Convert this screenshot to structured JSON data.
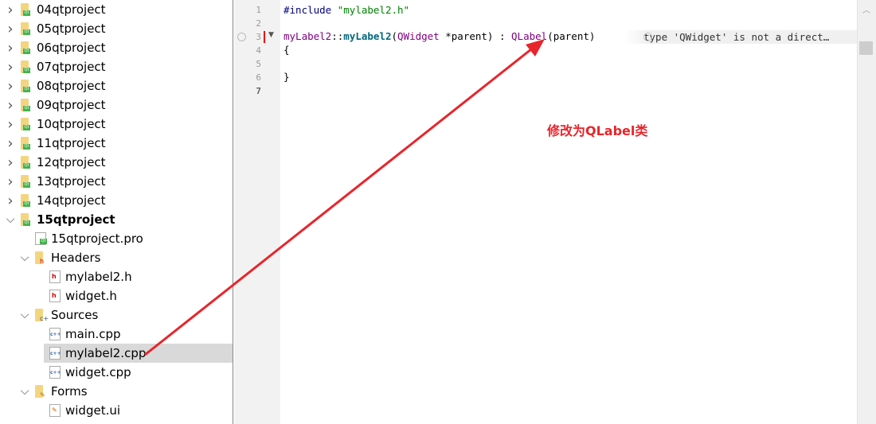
{
  "tree": [
    {
      "label": "04qtproject",
      "level": 0,
      "kind": "project",
      "expanded": false
    },
    {
      "label": "05qtproject",
      "level": 0,
      "kind": "project",
      "expanded": false
    },
    {
      "label": "06qtproject",
      "level": 0,
      "kind": "project",
      "expanded": false
    },
    {
      "label": "07qtproject",
      "level": 0,
      "kind": "project",
      "expanded": false
    },
    {
      "label": "08qtproject",
      "level": 0,
      "kind": "project",
      "expanded": false
    },
    {
      "label": "09qtproject",
      "level": 0,
      "kind": "project",
      "expanded": false
    },
    {
      "label": "10qtproject",
      "level": 0,
      "kind": "project",
      "expanded": false
    },
    {
      "label": "11qtproject",
      "level": 0,
      "kind": "project",
      "expanded": false
    },
    {
      "label": "12qtproject",
      "level": 0,
      "kind": "project",
      "expanded": false
    },
    {
      "label": "13qtproject",
      "level": 0,
      "kind": "project",
      "expanded": false
    },
    {
      "label": "14qtproject",
      "level": 0,
      "kind": "project",
      "expanded": false
    },
    {
      "label": "15qtproject",
      "level": 0,
      "kind": "project",
      "expanded": true,
      "bold": true
    },
    {
      "label": "15qtproject.pro",
      "level": 1,
      "kind": "pro"
    },
    {
      "label": "Headers",
      "level": 1,
      "kind": "folder-h",
      "expanded": true
    },
    {
      "label": "mylabel2.h",
      "level": 2,
      "kind": "h"
    },
    {
      "label": "widget.h",
      "level": 2,
      "kind": "h"
    },
    {
      "label": "Sources",
      "level": 1,
      "kind": "folder-cpp",
      "expanded": true
    },
    {
      "label": "main.cpp",
      "level": 2,
      "kind": "cpp"
    },
    {
      "label": "mylabel2.cpp",
      "level": 2,
      "kind": "cpp",
      "selected": true
    },
    {
      "label": "widget.cpp",
      "level": 2,
      "kind": "cpp"
    },
    {
      "label": "Forms",
      "level": 1,
      "kind": "folder-ui",
      "expanded": true
    },
    {
      "label": "widget.ui",
      "level": 2,
      "kind": "ui"
    }
  ],
  "editor": {
    "line_numbers": [
      "1",
      "2",
      "3",
      "4",
      "5",
      "6",
      "7"
    ],
    "lines": {
      "l1_kw": "#include",
      "l1_str": " \"mylabel2.h\"",
      "l3_a": "myLabel2",
      "l3_b": "::",
      "l3_c": "myLabel2",
      "l3_d": "(",
      "l3_e": "QWidget",
      "l3_f": " *parent) : ",
      "l3_g": "QLabel",
      "l3_h": "(parent)",
      "l4": "{",
      "l6": "}"
    },
    "hint": "type 'QWidget' is not a direct…"
  },
  "annotation": {
    "text": "修改为QLabel类",
    "color": "#e8252b"
  }
}
